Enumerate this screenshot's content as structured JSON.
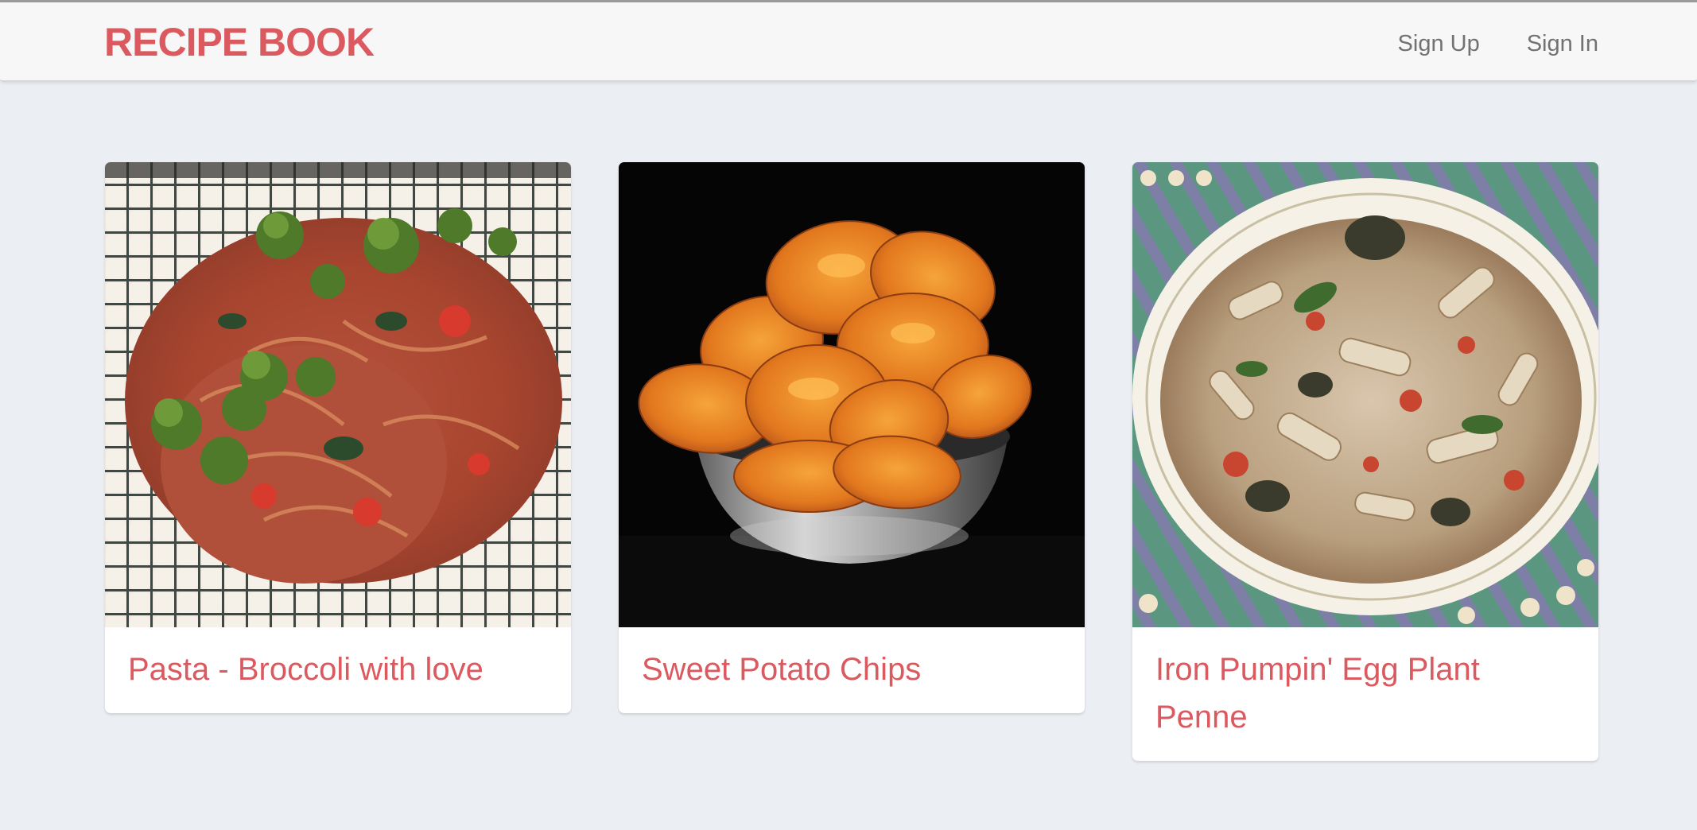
{
  "header": {
    "brand": "RECIPE BOOK",
    "nav": [
      {
        "label": "Sign Up"
      },
      {
        "label": "Sign In"
      }
    ]
  },
  "recipes": [
    {
      "title": "Pasta - Broccoli with love",
      "image": "pasta-broccoli-photo"
    },
    {
      "title": "Sweet Potato Chips",
      "image": "sweet-potato-chips-photo"
    },
    {
      "title": "Iron Pumpin' Egg Plant Penne",
      "image": "eggplant-penne-photo"
    }
  ],
  "colors": {
    "accent": "#da5a60",
    "background": "#ebeef3",
    "navbar": "#f7f7f8",
    "nav_text": "#727272"
  }
}
